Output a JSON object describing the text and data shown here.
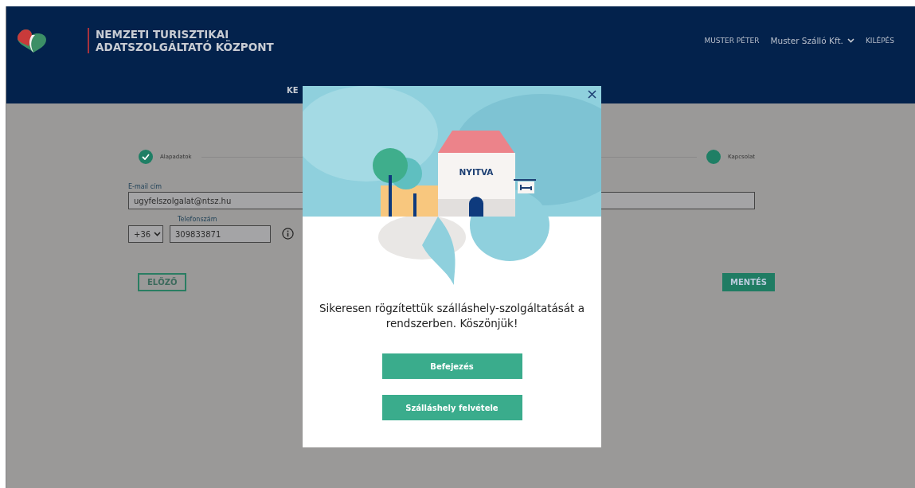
{
  "header": {
    "title_lines": [
      "NEMZETI TURISZTIKAI",
      "ADATSZOLGÁLTATÓ KÖZPONT"
    ],
    "user": "MUSTER PÉTER",
    "company": "Muster Szálló Kft.",
    "logout": "KILÉPÉS",
    "nav_visible": "KE"
  },
  "stepper": [
    {
      "label": "Alapadatok",
      "done": true
    },
    {
      "label": "Kapcsolat",
      "done": false
    }
  ],
  "form": {
    "email_label": "E-mail cím",
    "email_value": "ugyfelszolgalat@ntsz.hu",
    "country_code": "+36",
    "phone_label": "Telefonszám",
    "phone_value": "309833871"
  },
  "buttons": {
    "previous": "ELŐZŐ",
    "save": "MENTÉS"
  },
  "modal": {
    "sign_text": "NYITVA",
    "message": "Sikeresen rögzítettük szálláshely-szolgáltatását a rendszerben. Köszönjük!",
    "actions": [
      "Befejezés",
      "Szálláshely felvétele"
    ]
  }
}
